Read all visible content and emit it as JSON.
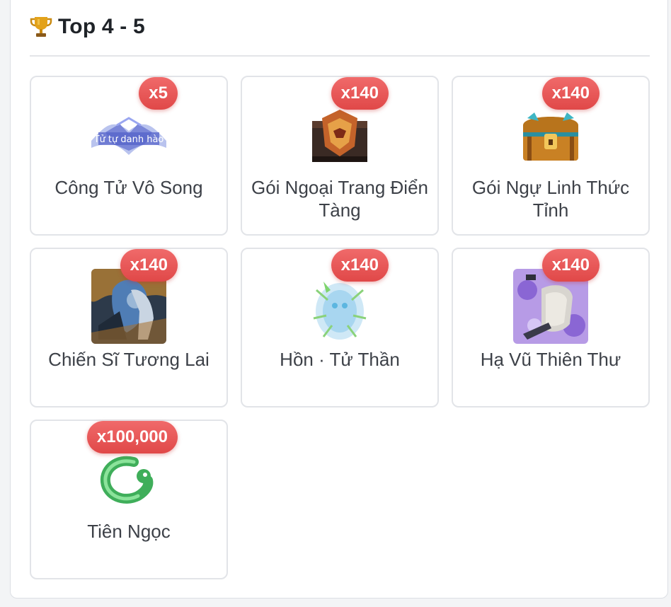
{
  "header": {
    "icon": "trophy-icon",
    "title": "Top 4 - 5"
  },
  "colors": {
    "badge": "#e55252",
    "card_border": "#e2e4e8",
    "text": "#3d4148"
  },
  "items": [
    {
      "name": "Công Tử Vô Song",
      "qty": "x5",
      "icon": "title-badge-icon"
    },
    {
      "name": "Gói Ngoại Trang Điển Tàng",
      "qty": "x140",
      "icon": "armor-chest-icon"
    },
    {
      "name": "Gói Ngự Linh Thức Tỉnh",
      "qty": "x140",
      "icon": "treasure-chest-icon"
    },
    {
      "name": "Chiến Sĩ Tương Lai",
      "qty": "x140",
      "icon": "warrior-portrait-icon"
    },
    {
      "name": "Hồn · Tử Thần",
      "qty": "x140",
      "icon": "spirit-icon"
    },
    {
      "name": "Hạ Vũ Thiên Thư",
      "qty": "x140",
      "icon": "scroll-icon"
    },
    {
      "name": "Tiên Ngọc",
      "qty": "x100,000",
      "icon": "jade-icon"
    }
  ]
}
